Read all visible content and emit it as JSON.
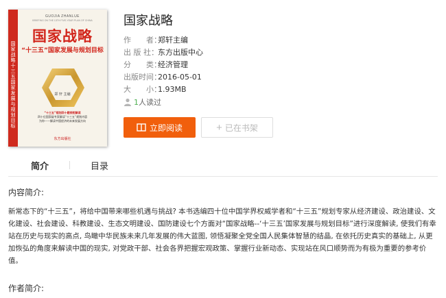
{
  "cover": {
    "spine_text": "国家战略十三五国家发展与规划目标",
    "pinyin": "GUOJIA ZHANLUE",
    "pinyin_sub": "BRIEFING ON THE 13TH FIVE-YEAR PLAN OF CHINA",
    "title": "国家战略",
    "subtitle": "“十三五”国家发展与规划目标",
    "editor": "郑 轩 主编",
    "blurb_1": "“十三五”规划四十题领衔解读",
    "blurb_2": "四十位国家级专家解读“十三五”规划内容",
    "blurb_3": "为你——解读中国经济的未来发展方向",
    "publisher": "东方出版社"
  },
  "book": {
    "title": "国家战略",
    "meta": [
      {
        "label": "作　　者：",
        "value": "郑轩主编"
      },
      {
        "label": "出 版 社：",
        "value": "东方出版中心"
      },
      {
        "label": "分　　类：",
        "value": "经济管理"
      },
      {
        "label": "出版时间：",
        "value": "2016-05-01"
      },
      {
        "label": "大　　小：",
        "value": "1.93MB"
      }
    ],
    "readers_count": "1",
    "readers_suffix": "人读过"
  },
  "actions": {
    "read_label": "立即阅读",
    "shelf_label": "已在书架"
  },
  "tabs": {
    "intro": "简介",
    "toc": "目录"
  },
  "content": {
    "intro_heading": "内容简介:",
    "intro_text": "新常态下的“十三五”，将给中国带来哪些机遇与挑战? 本书选编四十位中国学界权威学者和“十三五”规划专家从经济建设、政治建设、文化建设、社会建设、科教建设、生态文明建设、国防建设七个方面对“国家战略--‘十三五’国家发展与规划目标”进行深度解读, 使我们有幸站在历史与现实的高点, 鸟瞰中华民族未来几年发展的伟大蓝图, 领悟凝聚全党全国人民集体智慧的结晶, 在依托历史真实的基础上, 从更加恢弘的角度来解读中国的现实, 对党政干部、社会各界把握宏观政策、掌握行业新动态、实现站在风口顺势而为有极为重要的参考价值。",
    "author_heading": "作者简介:"
  },
  "colors": {
    "accent": "#f15f0c",
    "cover_red": "#d2261c",
    "readers_green": "#4caf50"
  }
}
